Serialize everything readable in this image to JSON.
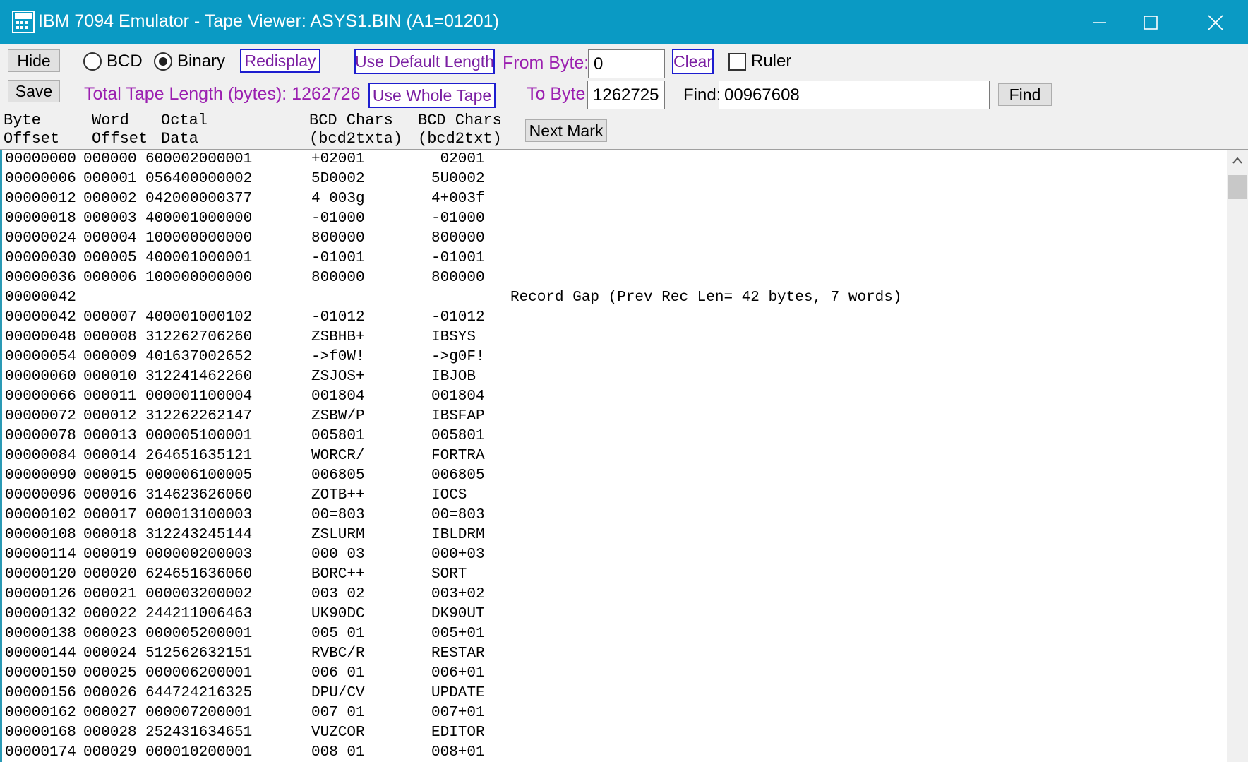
{
  "window": {
    "title": "IBM 7094 Emulator - Tape Viewer: ASYS1.BIN (A1=01201)",
    "titlebar_color": "#0a9ac4",
    "controls": [
      "minimize-icon",
      "maximize-icon",
      "close-icon"
    ]
  },
  "toolbar": {
    "hide_label": "Hide",
    "save_label": "Save",
    "bcd_label": "BCD",
    "binary_label": "Binary",
    "mode_selected": "Binary",
    "redisplay_label": "Redisplay",
    "use_default_length_label": "Use Default Length",
    "use_whole_tape_label": "Use Whole Tape",
    "total_length_text": "Total Tape Length (bytes): 1262726",
    "from_byte_label": "From Byte:",
    "from_byte_value": "0",
    "to_byte_label": "To Byte:",
    "to_byte_value": "1262725",
    "clear_label": "Clear",
    "ruler_label": "Ruler",
    "ruler_checked": false,
    "find_label": "Find:",
    "find_value": "00967608",
    "find_button_label": "Find",
    "next_mark_label": "Next Mark",
    "accent_color": "#9b1fb0",
    "button_border_color": "#1d1dcf"
  },
  "columns": {
    "byte_offset": "Byte\nOffset",
    "word_offset": "Word\nOffset",
    "octal_data": "Octal\nData",
    "bcd_txta": "BCD Chars\n(bcd2txta)",
    "bcd_txt": "BCD Chars\n(bcd2txt)"
  },
  "rows": [
    {
      "byte": "00000000",
      "word": "000000",
      "octal": "600002000001",
      "bcda": "+02001",
      "bcdt": " 02001"
    },
    {
      "byte": "00000006",
      "word": "000001",
      "octal": "056400000002",
      "bcda": "5D0002",
      "bcdt": "5U0002"
    },
    {
      "byte": "00000012",
      "word": "000002",
      "octal": "042000000377",
      "bcda": "4 003g",
      "bcdt": "4+003f"
    },
    {
      "byte": "00000018",
      "word": "000003",
      "octal": "400001000000",
      "bcda": "-01000",
      "bcdt": "-01000"
    },
    {
      "byte": "00000024",
      "word": "000004",
      "octal": "100000000000",
      "bcda": "800000",
      "bcdt": "800000"
    },
    {
      "byte": "00000030",
      "word": "000005",
      "octal": "400001000001",
      "bcda": "-01001",
      "bcdt": "-01001"
    },
    {
      "byte": "00000036",
      "word": "000006",
      "octal": "100000000000",
      "bcda": "800000",
      "bcdt": "800000"
    },
    {
      "byte": "00000042",
      "word": "",
      "octal": "",
      "bcda": "",
      "bcdt": "",
      "gap": "Record Gap (Prev Rec Len= 42 bytes, 7 words)"
    },
    {
      "byte": "00000042",
      "word": "000007",
      "octal": "400001000102",
      "bcda": "-01012",
      "bcdt": "-01012"
    },
    {
      "byte": "00000048",
      "word": "000008",
      "octal": "312262706260",
      "bcda": "ZSBHB+",
      "bcdt": "IBSYS"
    },
    {
      "byte": "00000054",
      "word": "000009",
      "octal": "401637002652",
      "bcda": "->f0W!",
      "bcdt": "->g0F!"
    },
    {
      "byte": "00000060",
      "word": "000010",
      "octal": "312241462260",
      "bcda": "ZSJOS+",
      "bcdt": "IBJOB"
    },
    {
      "byte": "00000066",
      "word": "000011",
      "octal": "000001100004",
      "bcda": "001804",
      "bcdt": "001804"
    },
    {
      "byte": "00000072",
      "word": "000012",
      "octal": "312262262147",
      "bcda": "ZSBW/P",
      "bcdt": "IBSFAP"
    },
    {
      "byte": "00000078",
      "word": "000013",
      "octal": "000005100001",
      "bcda": "005801",
      "bcdt": "005801"
    },
    {
      "byte": "00000084",
      "word": "000014",
      "octal": "264651635121",
      "bcda": "WORCR/",
      "bcdt": "FORTRA"
    },
    {
      "byte": "00000090",
      "word": "000015",
      "octal": "000006100005",
      "bcda": "006805",
      "bcdt": "006805"
    },
    {
      "byte": "00000096",
      "word": "000016",
      "octal": "314623626060",
      "bcda": "ZOTB++",
      "bcdt": "IOCS"
    },
    {
      "byte": "00000102",
      "word": "000017",
      "octal": "000013100003",
      "bcda": "00=803",
      "bcdt": "00=803"
    },
    {
      "byte": "00000108",
      "word": "000018",
      "octal": "312243245144",
      "bcda": "ZSLURM",
      "bcdt": "IBLDRM"
    },
    {
      "byte": "00000114",
      "word": "000019",
      "octal": "000000200003",
      "bcda": "000 03",
      "bcdt": "000+03"
    },
    {
      "byte": "00000120",
      "word": "000020",
      "octal": "624651636060",
      "bcda": "BORC++",
      "bcdt": "SORT"
    },
    {
      "byte": "00000126",
      "word": "000021",
      "octal": "000003200002",
      "bcda": "003 02",
      "bcdt": "003+02"
    },
    {
      "byte": "00000132",
      "word": "000022",
      "octal": "244211006463",
      "bcda": "UK90DC",
      "bcdt": "DK90UT"
    },
    {
      "byte": "00000138",
      "word": "000023",
      "octal": "000005200001",
      "bcda": "005 01",
      "bcdt": "005+01"
    },
    {
      "byte": "00000144",
      "word": "000024",
      "octal": "512562632151",
      "bcda": "RVBC/R",
      "bcdt": "RESTAR"
    },
    {
      "byte": "00000150",
      "word": "000025",
      "octal": "000006200001",
      "bcda": "006 01",
      "bcdt": "006+01"
    },
    {
      "byte": "00000156",
      "word": "000026",
      "octal": "644724216325",
      "bcda": "DPU/CV",
      "bcdt": "UPDATE"
    },
    {
      "byte": "00000162",
      "word": "000027",
      "octal": "000007200001",
      "bcda": "007 01",
      "bcdt": "007+01"
    },
    {
      "byte": "00000168",
      "word": "000028",
      "octal": "252431634651",
      "bcda": "VUZCOR",
      "bcdt": "EDITOR"
    },
    {
      "byte": "00000174",
      "word": "000029",
      "octal": "000010200001",
      "bcda": "008 01",
      "bcdt": "008+01"
    }
  ]
}
